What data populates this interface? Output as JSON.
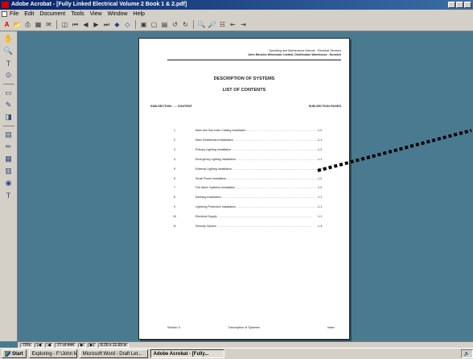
{
  "window": {
    "title": "Adobe Acrobat - [Fully Linked Electrical Volume 2 Book 1 & 2.pdf]"
  },
  "menu": [
    "File",
    "Edit",
    "Document",
    "Tools",
    "View",
    "Window",
    "Help"
  ],
  "toolbar": {
    "icons": [
      "acrobat-icon",
      "open-icon",
      "print-icon",
      "save-icon",
      "email-icon",
      "show-hide-navigation-icon",
      "first-page-icon",
      "previous-page-icon",
      "next-page-icon",
      "last-page-icon",
      "go-back-icon",
      "go-forward-icon",
      "actual-size-icon",
      "fit-page-icon",
      "fit-width-icon",
      "rotate-left-icon",
      "rotate-right-icon",
      "find-icon",
      "search-icon",
      "search-results-icon",
      "previous-highlight-icon",
      "next-highlight-icon"
    ]
  },
  "lefttools": {
    "icons": [
      "hand-icon",
      "zoom-icon",
      "text-select-icon",
      "crop-icon",
      "link-icon",
      "article-icon",
      "movie-icon",
      "note-icon",
      "pencil-icon",
      "form-icon",
      "graphics-select-icon",
      "stamp-icon",
      "highlight-icon"
    ]
  },
  "document": {
    "header_line1": "Operating and Maintenance Manual - Electrical Services",
    "header_line2": "John Menzies Wholesale Limited, Distribution Warehouse - Norwich",
    "title": "DESCRIPTION OF SYSTEMS",
    "subtitle": "LIST OF CONTENTS",
    "col_subsection": "SUB-SECTION",
    "col_content": "CONTENT",
    "col_pages": "SUB-SECTION PAGES",
    "rows": [
      {
        "n": "1",
        "content": "Main and Sub-main Cabling Installation",
        "page": "1-2"
      },
      {
        "n": "2",
        "content": "Main Switchboard Installation",
        "page": "1-1"
      },
      {
        "n": "3",
        "content": "Primary Lighting Installation",
        "page": "1-3"
      },
      {
        "n": "4",
        "content": "Emergency Lighting Installation",
        "page": "1-1"
      },
      {
        "n": "5",
        "content": "External Lighting Installation",
        "page": "1-1"
      },
      {
        "n": "6",
        "content": "Small Power Installation",
        "page": "1-2"
      },
      {
        "n": "7",
        "content": "Fire Alarm Systems Installation",
        "page": "1-2"
      },
      {
        "n": "8",
        "content": "Earthing Installation",
        "page": "1-1"
      },
      {
        "n": "9",
        "content": "Lightning Protection Installation",
        "page": "1-1"
      },
      {
        "n": "10",
        "content": "Electrical Supply",
        "page": "1-1"
      },
      {
        "n": "11",
        "content": "Security System",
        "page": "1-4"
      }
    ],
    "footer_left": "Section 3",
    "footer_center": "Description of Systems",
    "footer_right": "Index"
  },
  "statusbar": {
    "zoom": "70%",
    "page_indicator": "77 of 444",
    "page_size": "8.26 x 11.69 in"
  },
  "taskbar": {
    "start": "Start",
    "tasks": [
      {
        "label": "Exploring - F:\\John Menzie..."
      },
      {
        "label": "Microsoft Word - Draft Let..."
      },
      {
        "label": "Adobe Acrobat - [Fully..."
      }
    ]
  }
}
